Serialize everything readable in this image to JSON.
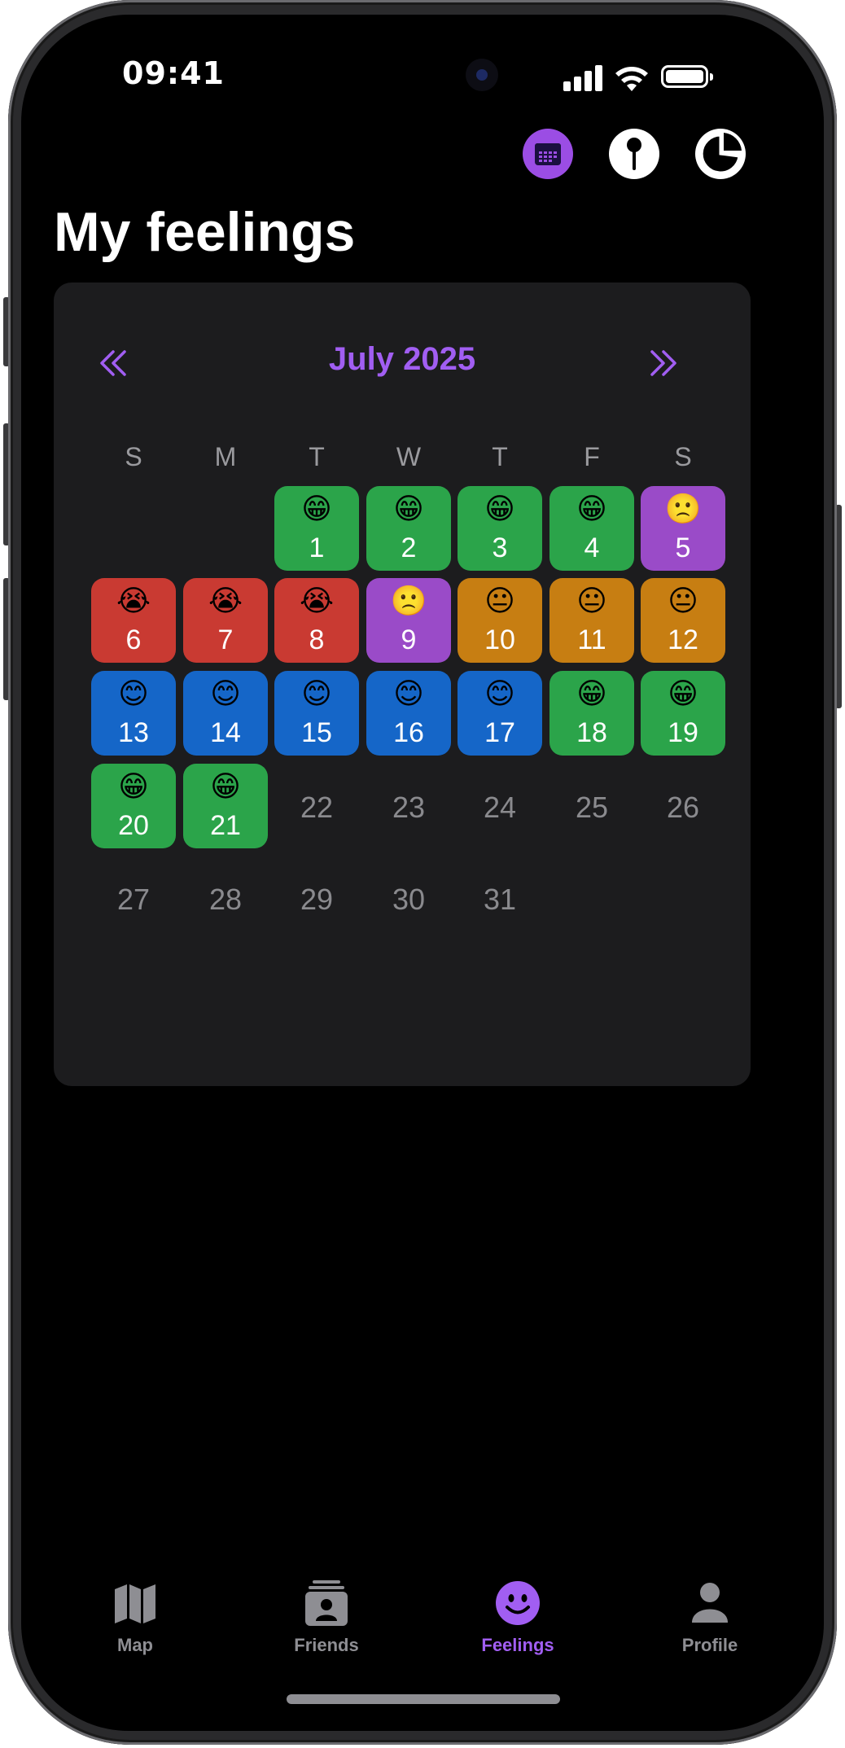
{
  "status_bar": {
    "time": "09:41"
  },
  "header": {
    "title": "My feelings"
  },
  "top_actions": [
    {
      "name": "calendar-view-button",
      "icon": "calendar-icon",
      "selected": true
    },
    {
      "name": "pin-view-button",
      "icon": "pin-icon",
      "selected": false
    },
    {
      "name": "chart-view-button",
      "icon": "pie-chart-icon",
      "selected": false
    }
  ],
  "calendar": {
    "month_label": "July 2025",
    "prev_icon": "double-chevron-left-icon",
    "next_icon": "double-chevron-right-icon",
    "weekdays": [
      "S",
      "M",
      "T",
      "W",
      "T",
      "F",
      "S"
    ],
    "first_weekday_index": 2,
    "days": [
      {
        "day": "1",
        "emoji": "😁",
        "color": "#2ba44a"
      },
      {
        "day": "2",
        "emoji": "😁",
        "color": "#2ba44a"
      },
      {
        "day": "3",
        "emoji": "😁",
        "color": "#2ba44a"
      },
      {
        "day": "4",
        "emoji": "😁",
        "color": "#2ba44a"
      },
      {
        "day": "5",
        "emoji": "🙁",
        "color": "#9a4bc8"
      },
      {
        "day": "6",
        "emoji": "😭",
        "color": "#c93a32"
      },
      {
        "day": "7",
        "emoji": "😭",
        "color": "#c93a32"
      },
      {
        "day": "8",
        "emoji": "😭",
        "color": "#c93a32"
      },
      {
        "day": "9",
        "emoji": "🙁",
        "color": "#9a4bc8"
      },
      {
        "day": "10",
        "emoji": "😐",
        "color": "#c77e12"
      },
      {
        "day": "11",
        "emoji": "😐",
        "color": "#c77e12"
      },
      {
        "day": "12",
        "emoji": "😐",
        "color": "#c77e12"
      },
      {
        "day": "13",
        "emoji": "😊",
        "color": "#1566c8"
      },
      {
        "day": "14",
        "emoji": "😊",
        "color": "#1566c8"
      },
      {
        "day": "15",
        "emoji": "😊",
        "color": "#1566c8"
      },
      {
        "day": "16",
        "emoji": "😊",
        "color": "#1566c8"
      },
      {
        "day": "17",
        "emoji": "😊",
        "color": "#1566c8"
      },
      {
        "day": "18",
        "emoji": "😁",
        "color": "#2ba44a"
      },
      {
        "day": "19",
        "emoji": "😁",
        "color": "#2ba44a"
      },
      {
        "day": "20",
        "emoji": "😁",
        "color": "#2ba44a"
      },
      {
        "day": "21",
        "emoji": "😁",
        "color": "#2ba44a"
      },
      {
        "day": "22",
        "emoji": "",
        "color": ""
      },
      {
        "day": "23",
        "emoji": "",
        "color": ""
      },
      {
        "day": "24",
        "emoji": "",
        "color": ""
      },
      {
        "day": "25",
        "emoji": "",
        "color": ""
      },
      {
        "day": "26",
        "emoji": "",
        "color": ""
      },
      {
        "day": "27",
        "emoji": "",
        "color": ""
      },
      {
        "day": "28",
        "emoji": "",
        "color": ""
      },
      {
        "day": "29",
        "emoji": "",
        "color": ""
      },
      {
        "day": "30",
        "emoji": "",
        "color": ""
      },
      {
        "day": "31",
        "emoji": "",
        "color": ""
      }
    ]
  },
  "tab_bar": {
    "items": [
      {
        "label": "Map",
        "icon": "map-icon",
        "active": false
      },
      {
        "label": "Friends",
        "icon": "friends-icon",
        "active": false
      },
      {
        "label": "Feelings",
        "icon": "smiley-icon",
        "active": true
      },
      {
        "label": "Profile",
        "icon": "person-icon",
        "active": false
      }
    ]
  },
  "colors": {
    "accent": "#a15ef2",
    "card": "#1c1c1e",
    "inactive_tab": "#8e8e93"
  }
}
